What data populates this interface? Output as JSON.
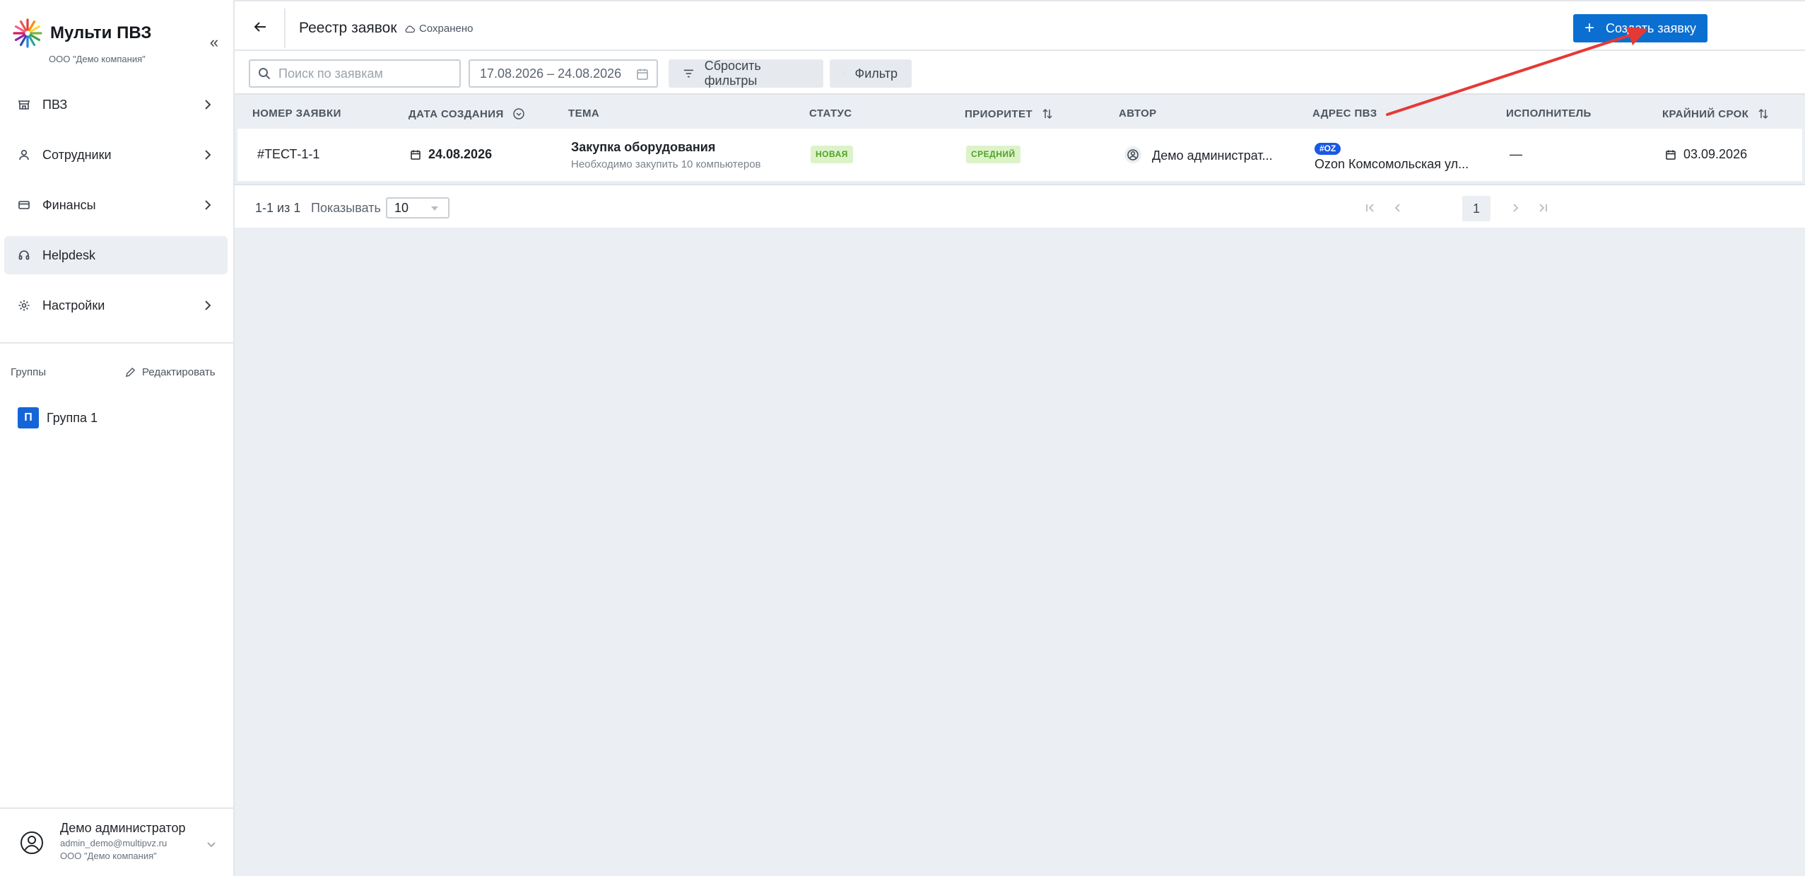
{
  "sidebar": {
    "brand_title": "Мульти ПВЗ",
    "brand_subtitle": "ООО \"Демо компания\"",
    "collapse_icon": "«",
    "nav": [
      {
        "label": "ПВЗ",
        "icon": "store-icon",
        "has_chevron": true
      },
      {
        "label": "Сотрудники",
        "icon": "user-icon",
        "has_chevron": true
      },
      {
        "label": "Финансы",
        "icon": "card-icon",
        "has_chevron": true
      },
      {
        "label": "Helpdesk",
        "icon": "headset-icon",
        "has_chevron": false,
        "active": true
      },
      {
        "label": "Настройки",
        "icon": "gear-icon",
        "has_chevron": true
      }
    ],
    "groups_label": "Группы",
    "groups_edit": "Редактировать",
    "group_badge": "П",
    "group_name": "Группа 1",
    "user": {
      "name": "Демо администратор",
      "email": "admin_demo@multipvz.ru",
      "company": "ООО \"Демо компания\""
    }
  },
  "topbar": {
    "title": "Реестр заявок",
    "saved": "Сохранено",
    "create_button": "Создать заявку"
  },
  "filters": {
    "search_placeholder": "Поиск по заявкам",
    "date_range": "17.08.2026 – 24.08.2026",
    "reset_label": "Сбросить фильтры",
    "filter_label": "Фильтр"
  },
  "table": {
    "columns": [
      "НОМЕР ЗАЯВКИ",
      "ДАТА СОЗДАНИЯ",
      "ТЕМА",
      "СТАТУС",
      "ПРИОРИТЕТ",
      "АВТОР",
      "АДРЕС ПВЗ",
      "ИСПОЛНИТЕЛЬ",
      "КРАЙНИЙ СРОК"
    ],
    "rows": [
      {
        "number": "#ТЕСТ-1-1",
        "created": "24.08.2026",
        "topic_title": "Закупка оборудования",
        "topic_desc": "Необходимо закупить 10 компьютеров",
        "status": "НОВАЯ",
        "priority": "СРЕДНИЙ",
        "author": "Демо администрат...",
        "address_tag": "#OZ",
        "address": "Ozon Комсомольская ул...",
        "executor": "—",
        "deadline": "03.09.2026"
      }
    ]
  },
  "pagination": {
    "range": "1-1 из 1",
    "show_label": "Показывать",
    "page_size": "10",
    "current_page": "1"
  },
  "colors": {
    "accent": "#0b6fd1",
    "annotation_arrow": "#e53935",
    "badge_green_bg": "#dcf3c9",
    "badge_green_text": "#51a227"
  }
}
